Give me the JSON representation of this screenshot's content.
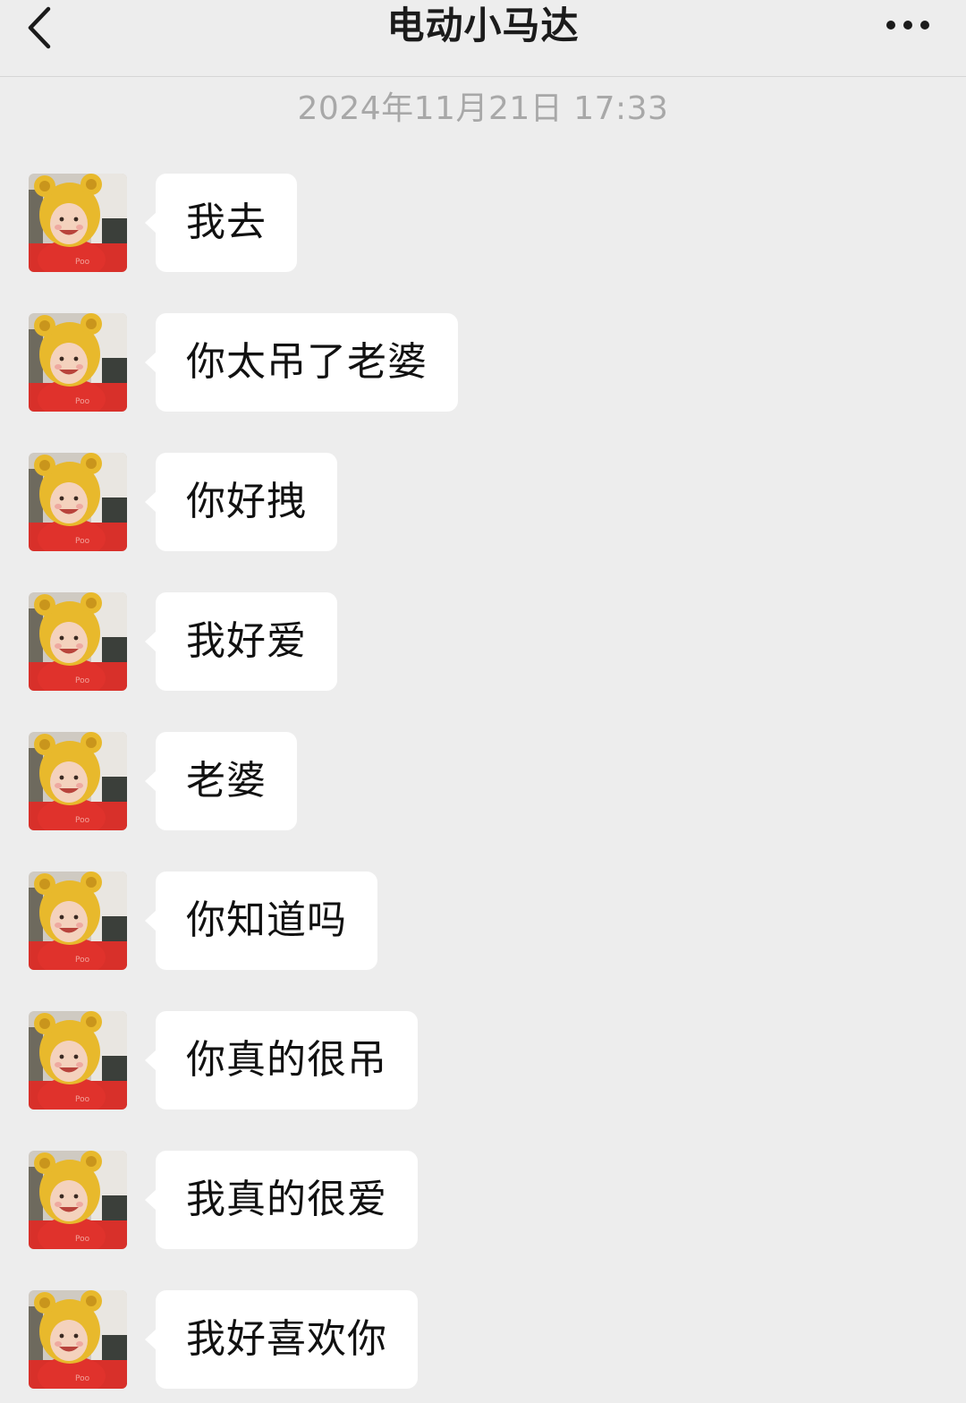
{
  "header": {
    "title": "电动小马达",
    "back_icon": "chevron-left-icon",
    "more_icon": "more-dots-icon"
  },
  "timestamp": "2024年11月21日 17:33",
  "messages": [
    {
      "text": "我去",
      "sender": "contact"
    },
    {
      "text": "你太吊了老婆",
      "sender": "contact"
    },
    {
      "text": "你好拽",
      "sender": "contact"
    },
    {
      "text": "我好爱",
      "sender": "contact"
    },
    {
      "text": "老婆",
      "sender": "contact"
    },
    {
      "text": "你知道吗",
      "sender": "contact"
    },
    {
      "text": "你真的很吊",
      "sender": "contact"
    },
    {
      "text": "我真的很爱",
      "sender": "contact"
    },
    {
      "text": "我好喜欢你",
      "sender": "contact"
    }
  ],
  "colors": {
    "background": "#ededed",
    "bubble": "#ffffff",
    "timestamp": "#a8a8a8"
  }
}
